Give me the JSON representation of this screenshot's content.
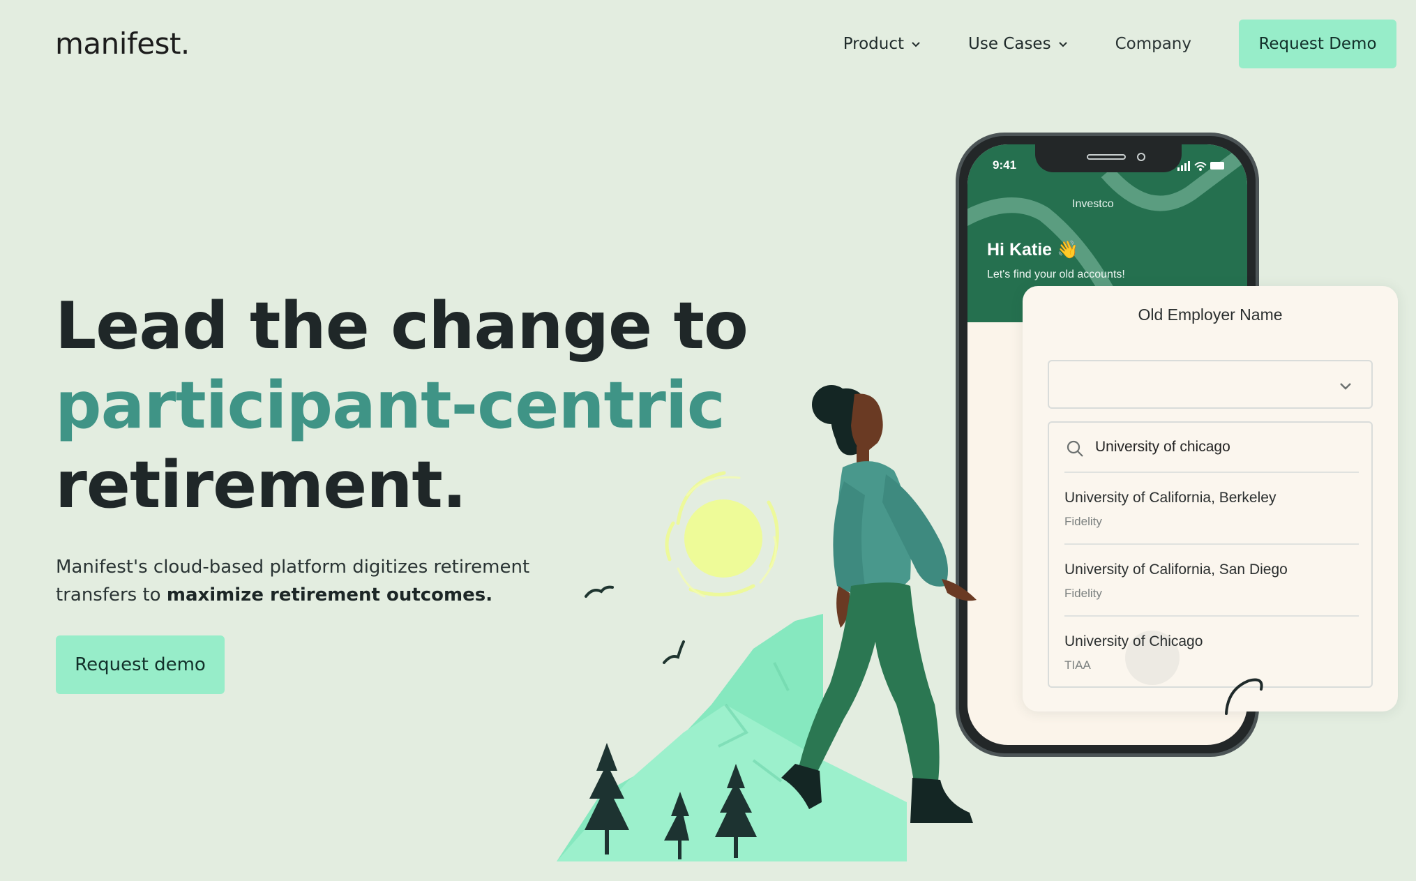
{
  "brand": {
    "logo": "manifest."
  },
  "nav": {
    "product": "Product",
    "use_cases": "Use Cases",
    "company": "Company",
    "cta": "Request Demo"
  },
  "hero": {
    "headline_line1": "Lead the change to",
    "headline_accent": "participant-centric",
    "headline_line3": "retirement.",
    "subtitle_text": "Manifest's cloud-based platform digitizes retirement transfers to",
    "subtitle_bold": "maximize retirement outcomes.",
    "cta": "Request demo"
  },
  "phone": {
    "time": "9:41",
    "brand": "Investco",
    "greeting": "Hi Katie 👋",
    "subtitle": "Let's find your old accounts!"
  },
  "employer_card": {
    "title": "Old Employer Name",
    "search_value": "University of chicago",
    "options": [
      {
        "name": "University of California, Berkeley",
        "provider": "Fidelity"
      },
      {
        "name": "University of California, San Diego",
        "provider": "Fidelity"
      },
      {
        "name": "University of Chicago",
        "provider": "TIAA"
      }
    ]
  },
  "colors": {
    "background": "#e3ede0",
    "accent_text": "#3f9486",
    "cta": "#97edc9",
    "phone_header": "#25704f"
  }
}
